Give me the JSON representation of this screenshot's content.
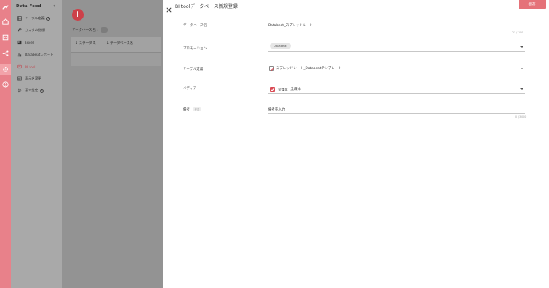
{
  "sidebar": {
    "title": "Data Feed",
    "items": [
      {
        "label": "テーブル定義",
        "icon": "table-icon",
        "help": "?"
      },
      {
        "label": "カスタム指標",
        "icon": "wrench-icon",
        "help": ""
      },
      {
        "label": "Excel",
        "icon": "excel-icon",
        "help": ""
      },
      {
        "label": "Databeatレポート",
        "icon": "bar-chart-icon",
        "help": ""
      },
      {
        "label": "BI tool",
        "icon": "bi-tool-icon",
        "help": ""
      },
      {
        "label": "表示名変更",
        "icon": "list-icon",
        "help": ""
      },
      {
        "label": "基本設定",
        "icon": "gear-icon",
        "help": "?"
      }
    ]
  },
  "main": {
    "fab_label": "+",
    "db_name_label": "データベース名 :",
    "columns": [
      "↓ ステータス",
      "↓ データベース名"
    ]
  },
  "drawer": {
    "close_label": "✕",
    "title": "BI toolデータベース新規登録",
    "save_label": "保存",
    "fields": {
      "db_name": {
        "label": "データベース名",
        "value": "Databeat_スプレッドシート",
        "counter": "21 / 100"
      },
      "promotion": {
        "label": "プロモーション",
        "chip": "Databeat"
      },
      "table_def": {
        "label": "テーブル定義",
        "value": "スプレッドシート_Databeatテンプレート"
      },
      "media": {
        "label": "メディア",
        "checkbox_label": "全媒体",
        "value": "全媒体"
      },
      "notes": {
        "label": "備考",
        "optional": "任意",
        "placeholder": "備考を入力",
        "counter": "0 / 3000"
      }
    }
  },
  "colors": {
    "accent": "#d94a54",
    "rail": "#e8818a",
    "save": "#e57279"
  }
}
